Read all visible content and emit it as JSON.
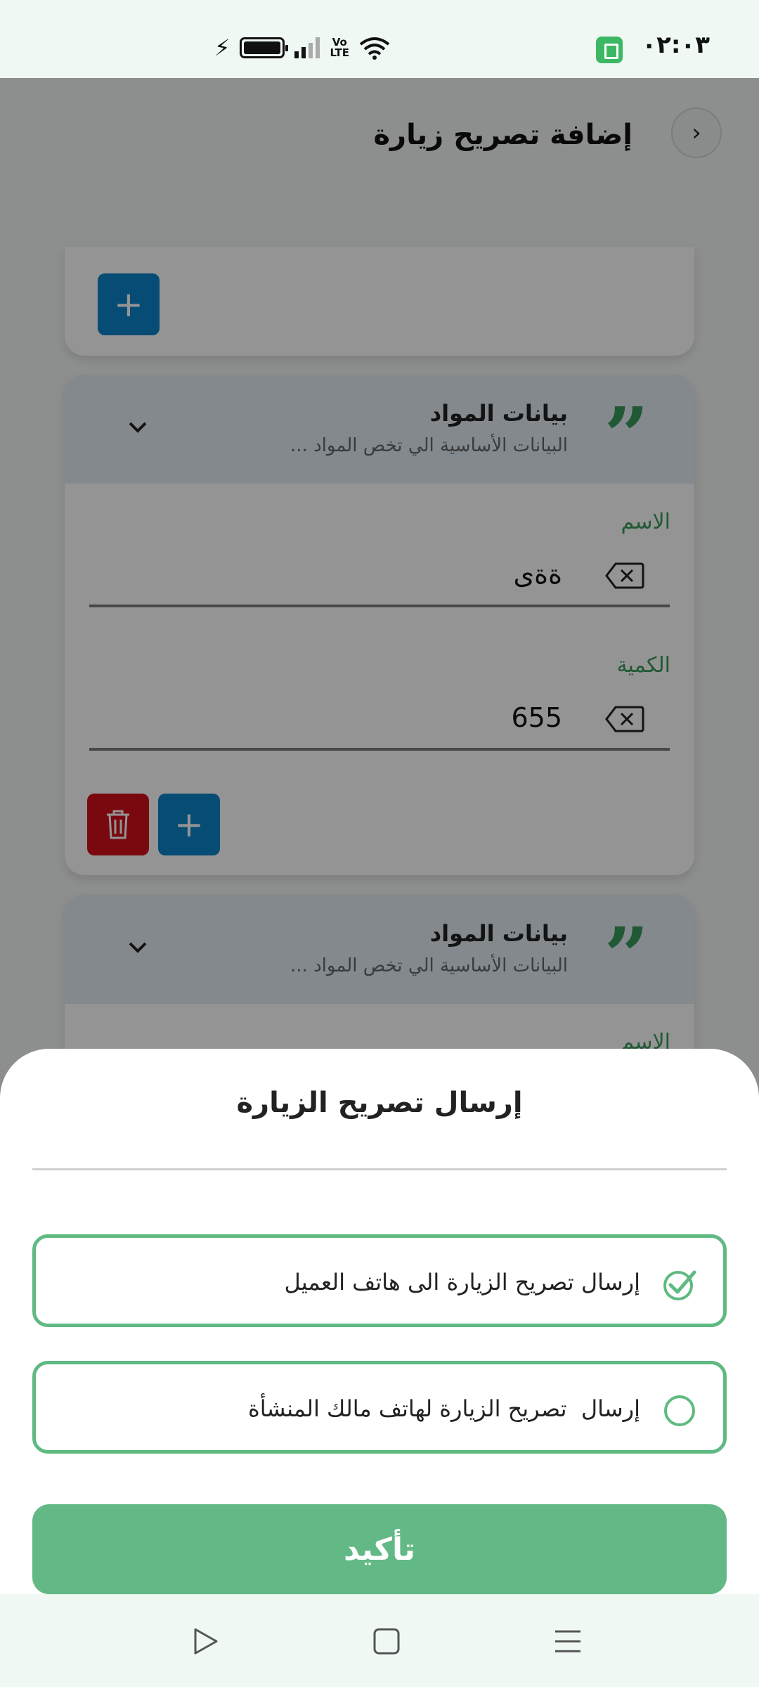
{
  "status_bar": {
    "time": "۰۲:۰۳",
    "volte_line1": "Vo",
    "volte_line2": "LTE"
  },
  "header": {
    "title": "إضافة تصريح زيارة",
    "back_icon": "chevron-right-icon"
  },
  "sections": [
    {
      "title": "بيانات المواد",
      "subtitle": "البيانات الأساسية الي تخص المواد ...",
      "fields": [
        {
          "label": "الاسم",
          "value": "ةةى"
        },
        {
          "label": "الكمية",
          "value": "655"
        }
      ]
    },
    {
      "title": "بيانات المواد",
      "subtitle": "البيانات الأساسية الي تخص المواد ...",
      "fields": [
        {
          "label": "الاسم",
          "value": ""
        }
      ]
    }
  ],
  "sheet": {
    "title": "إرسال تصريح الزيارة",
    "options": [
      {
        "label": "إرسال تصريح الزيارة الى هاتف العميل",
        "selected": true
      },
      {
        "label": "إرسال  تصريح الزيارة لهاتف مالك المنشأة",
        "selected": false
      }
    ],
    "confirm_label": "تأكيد"
  },
  "colors": {
    "accent_green": "#5fba81",
    "label_green": "#3a9a5c",
    "blue_button": "#0c83c8",
    "red_button": "#d0101a"
  }
}
